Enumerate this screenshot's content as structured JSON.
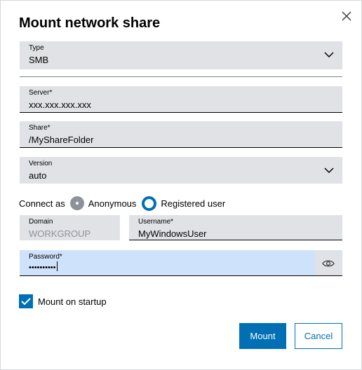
{
  "dialog": {
    "title": "Mount network share"
  },
  "fields": {
    "type": {
      "label": "Type",
      "value": "SMB"
    },
    "server": {
      "label": "Server*",
      "value": "xxx.xxx.xxx.xxx"
    },
    "share": {
      "label": "Share*",
      "value": "/MyShareFolder"
    },
    "version": {
      "label": "Version",
      "value": "auto"
    },
    "domain": {
      "label": "Domain",
      "value": "WORKGROUP"
    },
    "username": {
      "label": "Username*",
      "value": "MyWindowsUser"
    },
    "password": {
      "label": "Password*",
      "value": "••••••••••"
    }
  },
  "connect_as": {
    "label": "Connect as",
    "options": [
      "Anonymous",
      "Registered user"
    ],
    "selected": "Registered user"
  },
  "mount_on_startup": {
    "label": "Mount on startup",
    "checked": true
  },
  "buttons": {
    "mount": "Mount",
    "cancel": "Cancel"
  },
  "colors": {
    "accent": "#006fb4",
    "field_bg": "#e0e2e5",
    "active_field_bg": "#cfe2fb"
  },
  "icons": [
    "close-icon",
    "chevron-down-icon",
    "eye-icon",
    "checkmark-icon"
  ]
}
